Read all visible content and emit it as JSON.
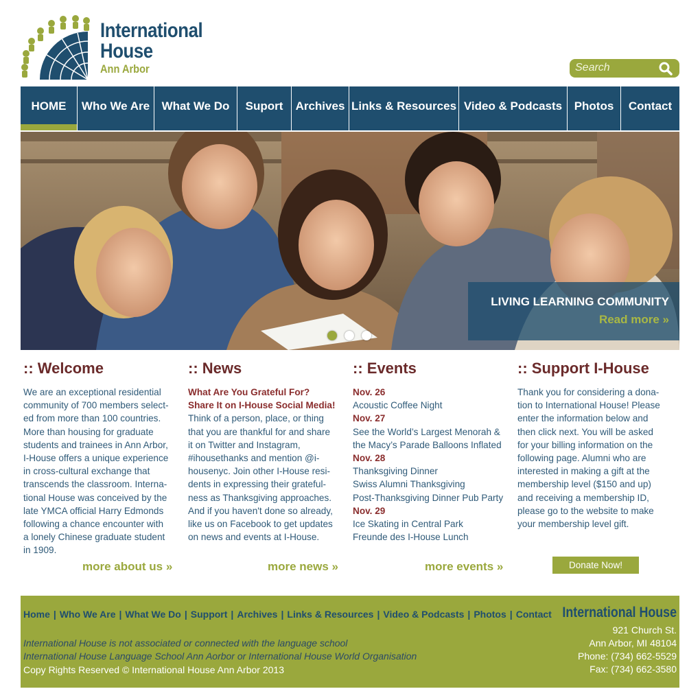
{
  "header": {
    "logo_line1": "International",
    "logo_line2": "House",
    "logo_line3": "Ann Arbor",
    "search_placeholder": "Search"
  },
  "nav": {
    "items": [
      "HOME",
      "Who We Are",
      "What We Do",
      "Suport",
      "Archives",
      "Links & Resources",
      "Video & Podcasts",
      "Photos",
      "Contact"
    ],
    "active": "HOME"
  },
  "hero": {
    "caption_title": "LIVING LEARNING COMMUNITY",
    "caption_more": "Read more »",
    "slides": 3,
    "active_slide": 1
  },
  "welcome": {
    "title": ":: Welcome",
    "lines": [
      "We are an exceptional residential",
      "community of 700 members select-",
      "ed from more than 100 countries.",
      "More than housing for graduate",
      "students and trainees in Ann Arbor,",
      "I-House offers a unique experience",
      "in cross-cultural exchange that",
      "transcends the classroom. Interna-",
      "tional House was conceived by the",
      "late YMCA official Harry Edmonds",
      "following a chance encounter with",
      "a lonely Chinese graduate student",
      "in 1909."
    ],
    "more": "more about us »"
  },
  "news": {
    "title": ":: News",
    "headline1": "What Are You Grateful For?",
    "headline2": "Share It on I-House Social Media!",
    "lines": [
      "Think of a person, place, or thing",
      "that you are thankful for and share",
      "it on Twitter and Instagram,",
      "#ihousethanks and mention @i-",
      "housenyc. Join other I-House resi-",
      "dents in expressing their grateful-",
      "ness as Thanksgiving approaches.",
      "And if you haven't done so already,",
      "like us on Facebook to get updates",
      "on news and events at I-House."
    ],
    "more": "more news »"
  },
  "events": {
    "title": ":: Events",
    "items": [
      {
        "text": "Nov. 26",
        "date": true
      },
      {
        "text": "Acoustic Coffee Night",
        "date": false
      },
      {
        "text": "Nov. 27",
        "date": true
      },
      {
        "text": "See the World’s Largest Menorah &",
        "date": false
      },
      {
        "text": "the Macy’s Parade Balloons Inflated",
        "date": false
      },
      {
        "text": "Nov. 28",
        "date": true
      },
      {
        "text": "Thanksgiving Dinner",
        "date": false
      },
      {
        "text": "Swiss Alumni Thanksgiving",
        "date": false
      },
      {
        "text": "Post-Thanksgiving Dinner Pub Party",
        "date": false
      },
      {
        "text": "Nov. 29",
        "date": true
      },
      {
        "text": "Ice Skating in Central Park",
        "date": false
      },
      {
        "text": "Freunde des I-House Lunch",
        "date": false
      }
    ],
    "more": "more events »"
  },
  "support": {
    "title": ":: Support I-House",
    "lines": [
      "Thank you for considering a dona-",
      "tion to International House! Please",
      "enter the information below and",
      "then click next. You will be asked",
      "for your billing information on the",
      "following page. Alumni who are",
      "interested in making a gift at the",
      "membership level ($150 and up)",
      "and receiving a membership ID,",
      "please go to the website to make",
      "your membership level gift."
    ],
    "donate": "Donate Now!"
  },
  "footer": {
    "nav": [
      "Home",
      "Who We Are",
      "What We Do",
      "Support",
      "Archives",
      "Links & Resources",
      "Video & Podcasts",
      "Photos",
      "Contact"
    ],
    "note1": "International House is not associated or connected with the language school",
    "note2": "International House Language School Ann Aorbor or International House World Organisation",
    "copyright": "Copy Rights Reserved © International House Ann Arbor 2013",
    "brand": "International House",
    "address1": "921 Church St.",
    "address2": "Ann Arbor, MI 48104",
    "phone": "Phone: (734) 662-5529",
    "fax": "Fax: (734) 662-3580"
  },
  "colors": {
    "navy": "#1f4e6e",
    "olive": "#9aa83d",
    "maroon": "#8a2d2d"
  }
}
